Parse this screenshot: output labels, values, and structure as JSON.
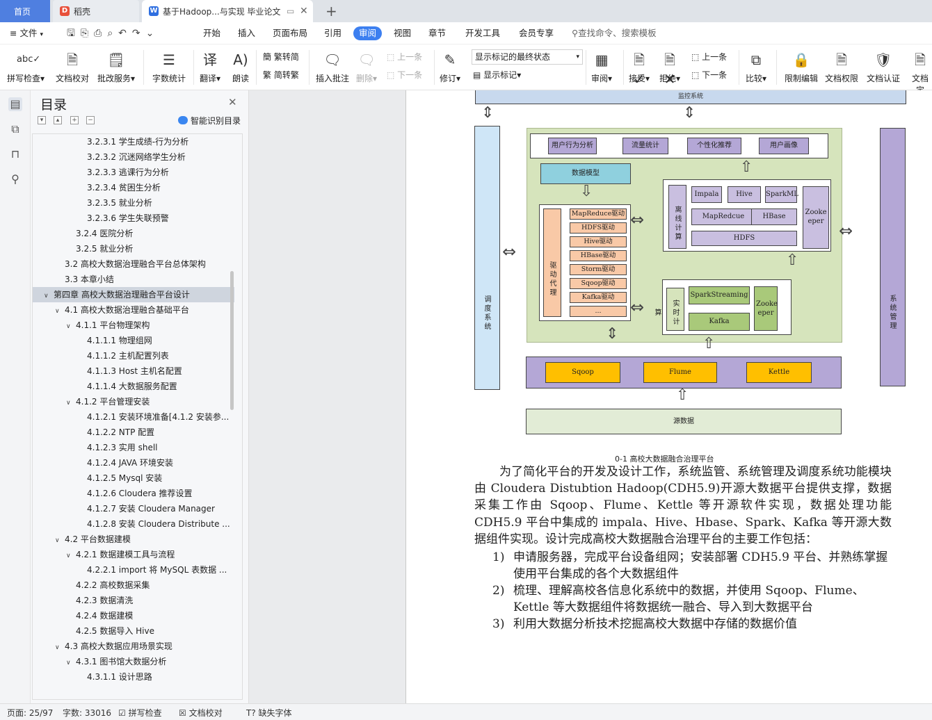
{
  "tabs": {
    "home": "首页",
    "daoke": "稻壳",
    "doc": "基于Hadoop...与实现 毕业论文"
  },
  "menu": {
    "file": "文件",
    "items": [
      "开始",
      "插入",
      "页面布局",
      "引用",
      "审阅",
      "视图",
      "章节",
      "开发工具",
      "会员专享"
    ],
    "search": "查找命令、搜索模板"
  },
  "ribbon": {
    "spell": "拼写检查",
    "doccheck": "文档校对",
    "annotate": "批改服务",
    "wordcount": "字数统计",
    "translate": "翻译",
    "read": "朗读",
    "trad": "繁转简",
    "simp": "简转繁",
    "insert_comment": "插入批注",
    "delete": "删除",
    "prev": "上一条",
    "next": "下一条",
    "revise": "修订",
    "mark_select": "显示标记的最终状态",
    "show_mark": "显示标记",
    "review": "审阅",
    "accept": "接受",
    "reject": "拒绝",
    "prev2": "上一条",
    "next2": "下一条",
    "compare": "比较",
    "restrict": "限制编辑",
    "perm": "文档权限",
    "cert": "文档认证",
    "docfix": "文档定"
  },
  "toc": {
    "title": "目录",
    "smart": "智能识别目录",
    "items": [
      {
        "level": 3,
        "text": "3.2.3.1  学生成绩-行为分析"
      },
      {
        "level": 3,
        "text": "3.2.3.2  沉迷网络学生分析"
      },
      {
        "level": 3,
        "text": "3.2.3.3  逃课行为分析"
      },
      {
        "level": 3,
        "text": "3.2.3.4  贫困生分析"
      },
      {
        "level": 3,
        "text": "3.2.3.5  就业分析"
      },
      {
        "level": 3,
        "text": "3.2.3.6  学生失联预警"
      },
      {
        "level": 2,
        "text": "3.2.4  医院分析"
      },
      {
        "level": 2,
        "text": "3.2.5  就业分析"
      },
      {
        "level": 1,
        "text": "3.2  高校大数据治理融合平台总体架构"
      },
      {
        "level": 1,
        "text": "3.3  本章小结"
      },
      {
        "level": 0,
        "text": "第四章  高校大数据治理融合平台设计",
        "caret": true,
        "selected": true
      },
      {
        "level": 1,
        "text": "4.1  高校大数据治理融合基础平台",
        "caret": true
      },
      {
        "level": 2,
        "text": "4.1.1  平台物理架构",
        "caret": true
      },
      {
        "level": 3,
        "text": "4.1.1.1  物理组网"
      },
      {
        "level": 3,
        "text": "4.1.1.2  主机配置列表"
      },
      {
        "level": 3,
        "text": "4.1.1.3 Host 主机名配置"
      },
      {
        "level": 3,
        "text": "4.1.1.4  大数据服务配置"
      },
      {
        "level": 2,
        "text": "4.1.2  平台管理安装",
        "caret": true
      },
      {
        "level": 3,
        "text": "4.1.2.1  安装环境准备[4.1.2 安装参..."
      },
      {
        "level": 3,
        "text": "4.1.2.2 NTP 配置"
      },
      {
        "level": 3,
        "text": "4.1.2.3  实用 shell"
      },
      {
        "level": 3,
        "text": "4.1.2.4 JAVA 环境安装"
      },
      {
        "level": 3,
        "text": "4.1.2.5 Mysql 安装"
      },
      {
        "level": 3,
        "text": "4.1.2.6 Cloudera 推荐设置"
      },
      {
        "level": 3,
        "text": "4.1.2.7  安装 Cloudera Manager"
      },
      {
        "level": 3,
        "text": "4.1.2.8  安装 Cloudera Distribute ..."
      },
      {
        "level": 1,
        "text": "4.2  平台数据建模",
        "caret": true
      },
      {
        "level": 2,
        "text": "4.2.1  数据建模工具与流程",
        "caret": true
      },
      {
        "level": 3,
        "text": "4.2.2.1 import 将 MySQL 表数据 ..."
      },
      {
        "level": 2,
        "text": "4.2.2  高校数据采集"
      },
      {
        "level": 2,
        "text": "4.2.3  数据清洗"
      },
      {
        "level": 2,
        "text": "4.2.4  数据建模"
      },
      {
        "level": 2,
        "text": "4.2.5 数据导入 Hive"
      },
      {
        "level": 1,
        "text": "4.3  高校大数据应用场景实现",
        "caret": true
      },
      {
        "level": 2,
        "text": "4.3.1  图书馆大数据分析",
        "caret": true
      },
      {
        "level": 3,
        "text": "4.3.1.1  设计思路"
      }
    ]
  },
  "diagram": {
    "top_label": "监控系统",
    "left_vertical": "调度系统",
    "right_vertical": "系统管理",
    "apps": [
      "用户行为分析",
      "流量统计",
      "个性化推荐",
      "用户画像"
    ],
    "model": "数据模型",
    "driver_proxy": "驱动代理",
    "drivers": [
      "MapReduce驱动",
      "HDFS驱动",
      "Hive驱动",
      "HBase驱动",
      "Storm驱动",
      "Sqoop驱动",
      "Kafka驱动",
      "..."
    ],
    "offline": "离线计算",
    "offline_items": [
      "Impala",
      "Hive",
      "SparkML",
      "MapRedcue",
      "HBase",
      "HDFS"
    ],
    "zk1": "Zooke eper",
    "realtime": "实时计算",
    "rt_items": [
      "SparkStreaming",
      "Kafka"
    ],
    "zk2": "Zooke eper",
    "collect": [
      "Sqoop",
      "Flume",
      "Kettle"
    ],
    "source": "源数据",
    "caption": "0-1 高校大数据融合治理平台"
  },
  "body": {
    "para": "为了简化平台的开发及设计工作，系统监管、系统管理及调度系统功能模块由 Cloudera Distubtion Hadoop(CDH5.9)开源大数据平台提供支撑，数据采集工作由 Sqoop、Flume、Kettle 等开源软件实现，数据处理功能 CDH5.9 平台中集成的 impala、Hive、Hbase、Spark、Kafka 等开源大数据组件实现。设计完成高校大数据融合治理平台的主要工作包括：",
    "list": [
      {
        "num": "1)",
        "text": "申请服务器，完成平台设备组网；安装部署 CDH5.9 平台、并熟练掌握使用平台集成的各个大数据组件"
      },
      {
        "num": "2)",
        "text": "梳理、理解高校各信息化系统中的数据，并使用 Sqoop、Flume、Kettle 等大数据组件将数据统一融合、导入到大数据平台"
      },
      {
        "num": "3)",
        "text": "利用大数据分析技术挖掘高校大数据中存储的数据价值"
      }
    ]
  },
  "status": {
    "page": "页面: 25/97",
    "words": "字数: 33016",
    "spell": "拼写检查",
    "check": "文档校对",
    "font": "缺失字体"
  },
  "colors": {
    "accent": "#3c7ff0",
    "green_panel": "#d6e4bc",
    "violet": "#b4a7d6",
    "blue_col": "#cfe6f7",
    "orange": "#f9c9a7",
    "gold": "#ffbf00",
    "model_blue": "#8fd0de",
    "offline_bg": "#c9bfe0"
  }
}
